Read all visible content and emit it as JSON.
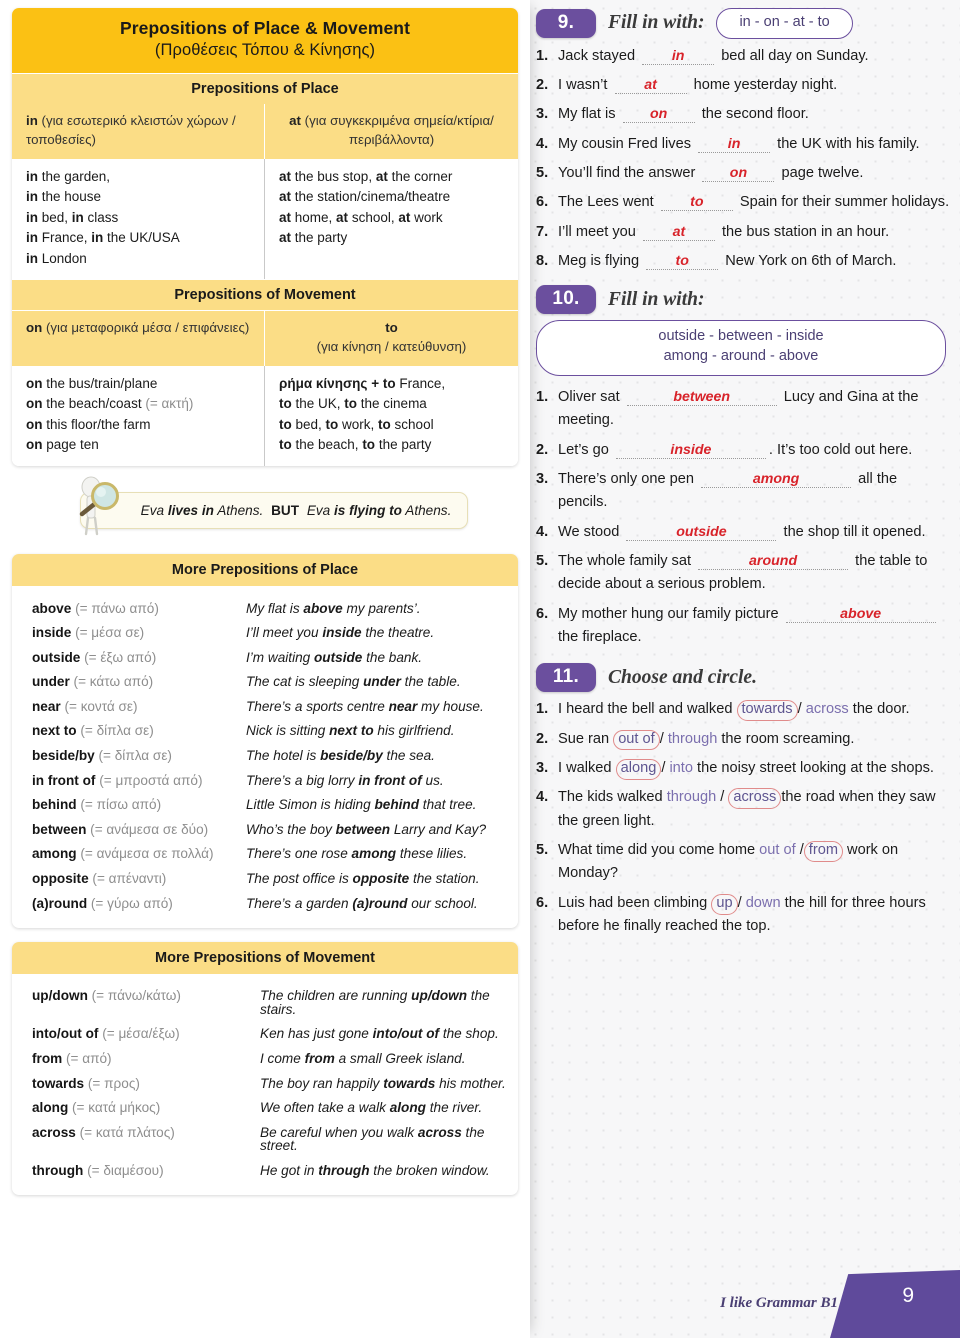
{
  "left": {
    "title_en": "Prepositions of Place & Movement",
    "title_gk": "(Προθέσεις Τόπου & Κίνησης)",
    "place_header": "Prepositions of Place",
    "place_cols": [
      {
        "word": "in",
        "note": "(για εσωτερικό κλειστών χώρων / τοποθεσίες)"
      },
      {
        "word": "at",
        "note": "(για συγκεκριμένα σημεία/κτίρια/ περιβάλλοντα)"
      }
    ],
    "place_examples_in": [
      "in the garden,",
      "in the house",
      "in bed, in class",
      "in France, in the UK/USA",
      "in London"
    ],
    "place_examples_at": [
      "at the bus stop, at the corner",
      "at the station/cinema/theatre",
      "at home, at school, at work",
      "at the party"
    ],
    "movement_header": "Prepositions of Movement",
    "movement_cols": [
      {
        "word": "on",
        "note": "(για μεταφορικά μέσα / επιφάνειες)"
      },
      {
        "word": "to",
        "note": "(για κίνηση / κατεύθυνση)"
      }
    ],
    "movement_examples_on": [
      "on the bus/train/plane",
      "on the beach/coast (= ακτή)",
      "on this floor/the farm",
      "on page ten"
    ],
    "movement_examples_to": [
      "ρήμα κίνησης + to France,",
      "to the UK, to the cinema",
      "to bed, to work, to school",
      "to the beach, to the party"
    ],
    "tip": {
      "first": "Eva lives in Athens.",
      "but": "BUT",
      "second": "Eva is flying to Athens.",
      "icon": "magnifier-character-icon"
    },
    "more_place_header": "More Prepositions of Place",
    "more_place": [
      {
        "term": "above",
        "gk": "(= πάνω από)",
        "example": "My flat is above my parents’."
      },
      {
        "term": "inside",
        "gk": "(= μέσα σε)",
        "example": "I’ll meet you inside the theatre."
      },
      {
        "term": "outside",
        "gk": "(= έξω από)",
        "example": "I’m waiting outside the bank."
      },
      {
        "term": "under",
        "gk": "(= κάτω από)",
        "example": "The cat is sleeping under the table."
      },
      {
        "term": "near",
        "gk": "(= κοντά σε)",
        "example": "There’s a sports centre near my house."
      },
      {
        "term": "next to",
        "gk": "(= δίπλα σε)",
        "example": "Nick is sitting next to his girlfriend."
      },
      {
        "term": "beside/by",
        "gk": "(= δίπλα σε)",
        "example": "The hotel is beside/by the sea."
      },
      {
        "term": "in front of",
        "gk": "(= μπροστά από)",
        "example": "There’s a big lorry in front of us."
      },
      {
        "term": "behind",
        "gk": "(= πίσω από)",
        "example": "Little Simon is hiding behind that tree."
      },
      {
        "term": "between",
        "gk": "(= ανάμεσα σε δύο)",
        "example": "Who’s the boy between Larry and Kay?"
      },
      {
        "term": "among",
        "gk": "(= ανάμεσα σε πολλά)",
        "example": "There’s one rose among these lilies."
      },
      {
        "term": "opposite",
        "gk": "(= απέναντι)",
        "example": "The post office is opposite the station."
      },
      {
        "term": "(a)round",
        "gk": "(= γύρω από)",
        "example": "There’s a garden (a)round our school."
      }
    ],
    "more_movement_header": "More Prepositions of Movement",
    "more_movement": [
      {
        "term": "up/down",
        "gk": "(= πάνω/κάτω)",
        "example": "The children are running up/down the stairs."
      },
      {
        "term": "into/out of",
        "gk": "(= μέσα/έξω)",
        "example": "Ken has just gone into/out of the shop."
      },
      {
        "term": "from",
        "gk": "(= από)",
        "example": "I come from a small Greek island."
      },
      {
        "term": "towards",
        "gk": "(= προς)",
        "example": "The boy ran happily towards his mother."
      },
      {
        "term": "along",
        "gk": "(= κατά μήκος)",
        "example": "We often take a walk along the river."
      },
      {
        "term": "across",
        "gk": "(= κατά πλάτος)",
        "example": "Be careful when you walk across the street."
      },
      {
        "term": "through",
        "gk": "(= διαμέσου)",
        "example": "He got in through the broken window."
      }
    ]
  },
  "right": {
    "ex9": {
      "number": "9.",
      "title": "Fill in with:",
      "wordbank": "in - on - at - to",
      "items": [
        {
          "n": "1.",
          "before": "Jack stayed",
          "answer": "in",
          "after": "bed all day on Sunday."
        },
        {
          "n": "2.",
          "before": "I wasn’t",
          "answer": "at",
          "after": "home yesterday night."
        },
        {
          "n": "3.",
          "before": "My flat is",
          "answer": "on",
          "after": "the second floor."
        },
        {
          "n": "4.",
          "before": "My cousin Fred lives",
          "answer": "in",
          "after": "the UK with his family."
        },
        {
          "n": "5.",
          "before": "You’ll find the answer",
          "answer": "on",
          "after": "page twelve."
        },
        {
          "n": "6.",
          "before": "The Lees went",
          "answer": "to",
          "after": "Spain for their summer holidays."
        },
        {
          "n": "7.",
          "before": "I’ll meet you",
          "answer": "at",
          "after": "the bus station in an hour."
        },
        {
          "n": "8.",
          "before": "Meg is flying",
          "answer": "to",
          "after": "New York on 6th of March."
        }
      ]
    },
    "ex10": {
      "number": "10.",
      "title": "Fill in with:",
      "wordbank_line1": "outside  -  between  -  inside",
      "wordbank_line2": "among  -  around  -  above",
      "items": [
        {
          "n": "1.",
          "before": "Oliver sat",
          "answer": "between",
          "after": "Lucy and Gina at the meeting."
        },
        {
          "n": "2.",
          "before": "Let’s go",
          "answer": "inside",
          "after": ". It’s too cold out here."
        },
        {
          "n": "3.",
          "before": "There’s only one pen",
          "answer": "among",
          "after": "all the pencils."
        },
        {
          "n": "4.",
          "before": "We stood",
          "answer": "outside",
          "after": "the shop till it opened."
        },
        {
          "n": "5.",
          "before": "The whole family sat",
          "answer": "around",
          "after": "the table to decide about a serious problem."
        },
        {
          "n": "6.",
          "before": "My mother hung our family picture",
          "answer": "above",
          "after": "the fireplace."
        }
      ]
    },
    "ex11": {
      "number": "11.",
      "title": "Choose and circle.",
      "items": [
        {
          "n": "1.",
          "before": "I heard the bell and walked",
          "opt1": "towards",
          "opt2": "across",
          "circled": 1,
          "after": "the door."
        },
        {
          "n": "2.",
          "before": "Sue ran",
          "opt1": "out of",
          "opt2": "through",
          "circled": 1,
          "after": "the room screaming."
        },
        {
          "n": "3.",
          "before": "I walked",
          "opt1": "along",
          "opt2": "into",
          "circled": 1,
          "after": "the noisy street looking at the shops."
        },
        {
          "n": "4.",
          "before": "The kids walked",
          "opt1": "through",
          "opt2": "across",
          "circled": 2,
          "after": "the road when they saw the green light."
        },
        {
          "n": "5.",
          "before": "What time did you come home",
          "opt1": "out of",
          "opt2": "from",
          "circled": 2,
          "after": "work on Monday?"
        },
        {
          "n": "6.",
          "before": "Luis had been climbing",
          "opt1": "up",
          "opt2": "down",
          "circled": 1,
          "after": "the hill for three hours before he finally reached the top."
        }
      ]
    },
    "footer": {
      "brand": "I like Grammar B1",
      "page": "9"
    }
  },
  "colors": {
    "title_yellow": "#fbc114",
    "sub_yellow": "#fbdd86",
    "purple": "#6b4f9e",
    "answer_red": "#d8232a",
    "option_purple": "#7b6fae",
    "circle_red": "#e08b8b"
  }
}
